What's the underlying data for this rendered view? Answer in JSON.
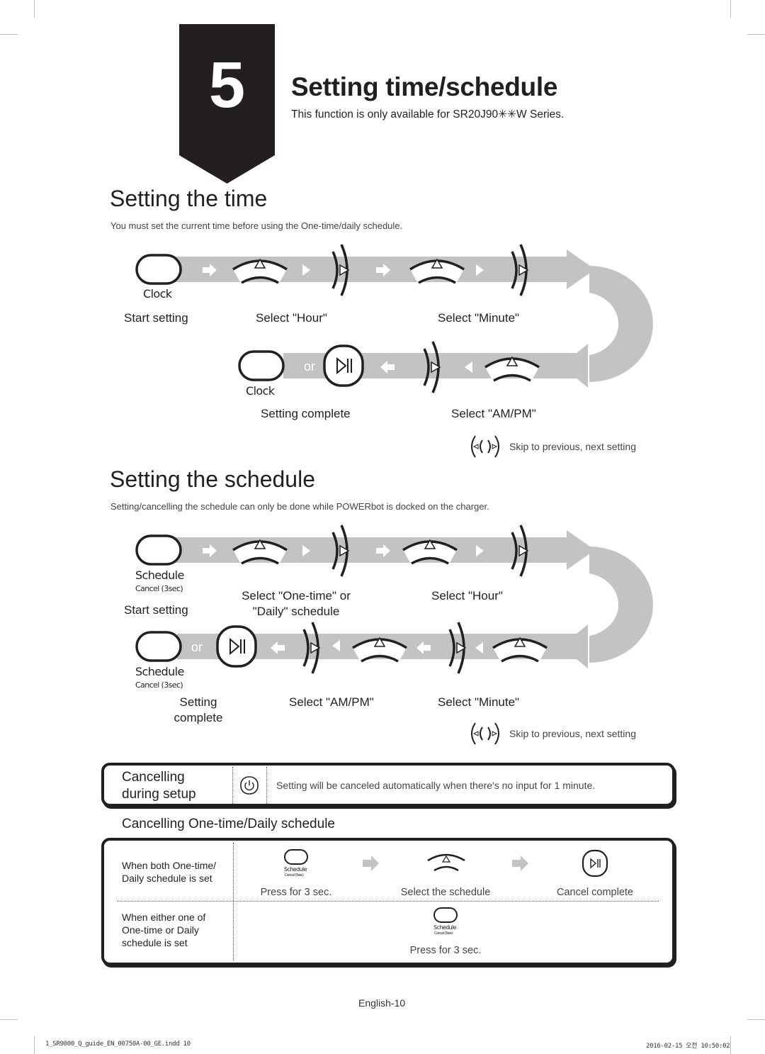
{
  "chapter": {
    "number": "5",
    "title": "Setting time/schedule",
    "subtitle": "This function is only available for SR20J90✳✳W Series."
  },
  "time_section": {
    "heading": "Setting the time",
    "note": "You must set the current time before using the One-time/daily schedule.",
    "button_caption": "Clock",
    "or_text": "or",
    "steps": {
      "start": "Start setting",
      "hour": "Select \"Hour\"",
      "minute": "Select \"Minute\"",
      "ampm": "Select \"AM/PM\"",
      "complete": "Setting complete"
    },
    "skip_legend": "Skip to previous, next setting"
  },
  "schedule_section": {
    "heading": "Setting the schedule",
    "note": "Setting/cancelling the schedule can only be done while POWERbot is docked on the charger.",
    "button_caption": "Schedule",
    "button_subcaption": "Cancel (3sec)",
    "or_text": "or",
    "steps": {
      "start": "Start setting",
      "type_line1": "Select \"One-time\" or",
      "type_line2": "\"Daily\" schedule",
      "hour": "Select \"Hour\"",
      "minute": "Select \"Minute\"",
      "ampm": "Select \"AM/PM\"",
      "complete_line1": "Setting",
      "complete_line2": "complete"
    },
    "skip_legend": "Skip to previous, next setting"
  },
  "cancel_setup": {
    "title_line1": "Cancelling",
    "title_line2": "during setup",
    "icon": "power-icon",
    "text": "Setting will be canceled automatically when there's no input for 1 minute."
  },
  "cancel_schedule": {
    "heading": "Cancelling One-time/Daily schedule",
    "rows": [
      {
        "label_line1": "When both One-time/",
        "label_line2": "Daily schedule is set",
        "label_line3": "",
        "steps": [
          "Press for 3 sec.",
          "Select the schedule",
          "Cancel complete"
        ]
      },
      {
        "label_line1": "When either one of",
        "label_line2": "One-time or Daily",
        "label_line3": "schedule is set",
        "steps": [
          "Press for 3 sec."
        ]
      }
    ],
    "mini_button_caption": "Schedule",
    "mini_button_subcaption": "Cancel (3sec)"
  },
  "footer": {
    "page_label": "English-10",
    "file_slug": "1_SR9000_Q_guide_EN_00750A-00_GE.indd   10",
    "timestamp": "2016-02-15   오전 10:50:02"
  },
  "colors": {
    "ink": "#231f20",
    "band_gray": "#c2c3c5",
    "tab_black": "#231f20"
  }
}
